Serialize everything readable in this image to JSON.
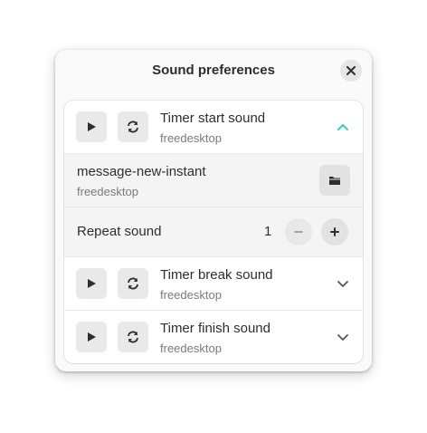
{
  "dialog": {
    "title": "Sound preferences",
    "close_icon": "close-icon"
  },
  "rows": [
    {
      "title": "Timer start sound",
      "subtitle": "freedesktop",
      "expanded": true,
      "accent": "#33d1b1"
    },
    {
      "title": "Timer break sound",
      "subtitle": "freedesktop",
      "expanded": false
    },
    {
      "title": "Timer finish sound",
      "subtitle": "freedesktop",
      "expanded": false
    }
  ],
  "sound_file": {
    "name": "message-new-instant",
    "source": "freedesktop",
    "button_icon": "folder-icon"
  },
  "repeat": {
    "label": "Repeat sound",
    "value": "1"
  }
}
